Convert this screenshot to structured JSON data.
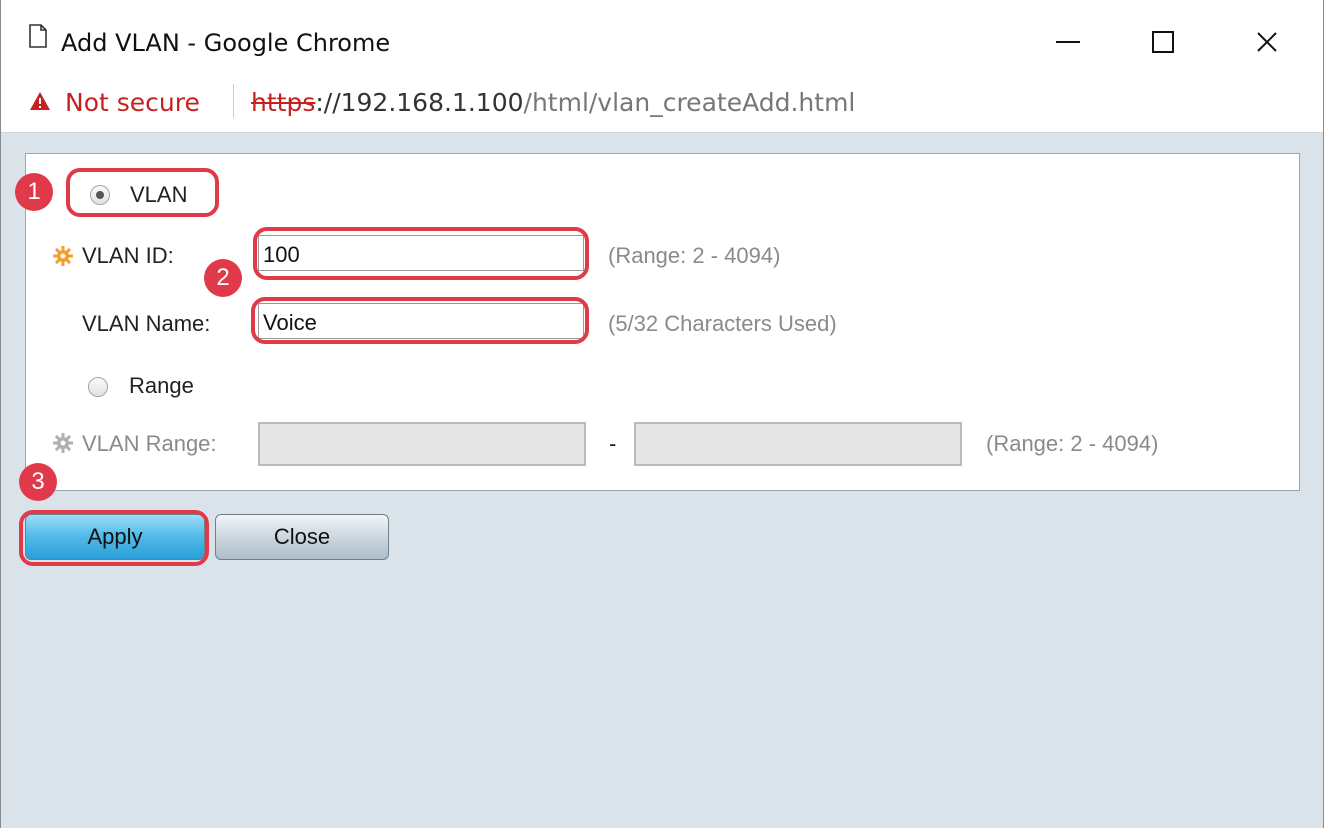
{
  "window": {
    "title": "Add VLAN - Google Chrome",
    "controls": {
      "minimize": "—",
      "maximize": "☐",
      "close": "✕"
    }
  },
  "address_bar": {
    "security_label": "Not secure",
    "url_scheme": "https",
    "url_host": "://192.168.1.100",
    "url_path": "/html/vlan_createAdd.html"
  },
  "form": {
    "vlan_radio_label": "VLAN",
    "vlan_id_label": "VLAN ID:",
    "vlan_id_value": "100",
    "vlan_id_hint": "(Range: 2 - 4094)",
    "vlan_name_label": "VLAN Name:",
    "vlan_name_value": "Voice",
    "vlan_name_hint": "(5/32 Characters Used)",
    "range_radio_label": "Range",
    "vlan_range_label": "VLAN Range:",
    "range_separator": "-",
    "vlan_range_hint": "(Range: 2 - 4094)"
  },
  "buttons": {
    "apply": "Apply",
    "close": "Close"
  },
  "annotations": {
    "step1": "1",
    "step2": "2",
    "step3": "3"
  },
  "colors": {
    "highlight": "#e03a4a",
    "not_secure": "#c5221f",
    "required_gear": "#f0a030",
    "disabled_gear": "#b0b0b0"
  }
}
